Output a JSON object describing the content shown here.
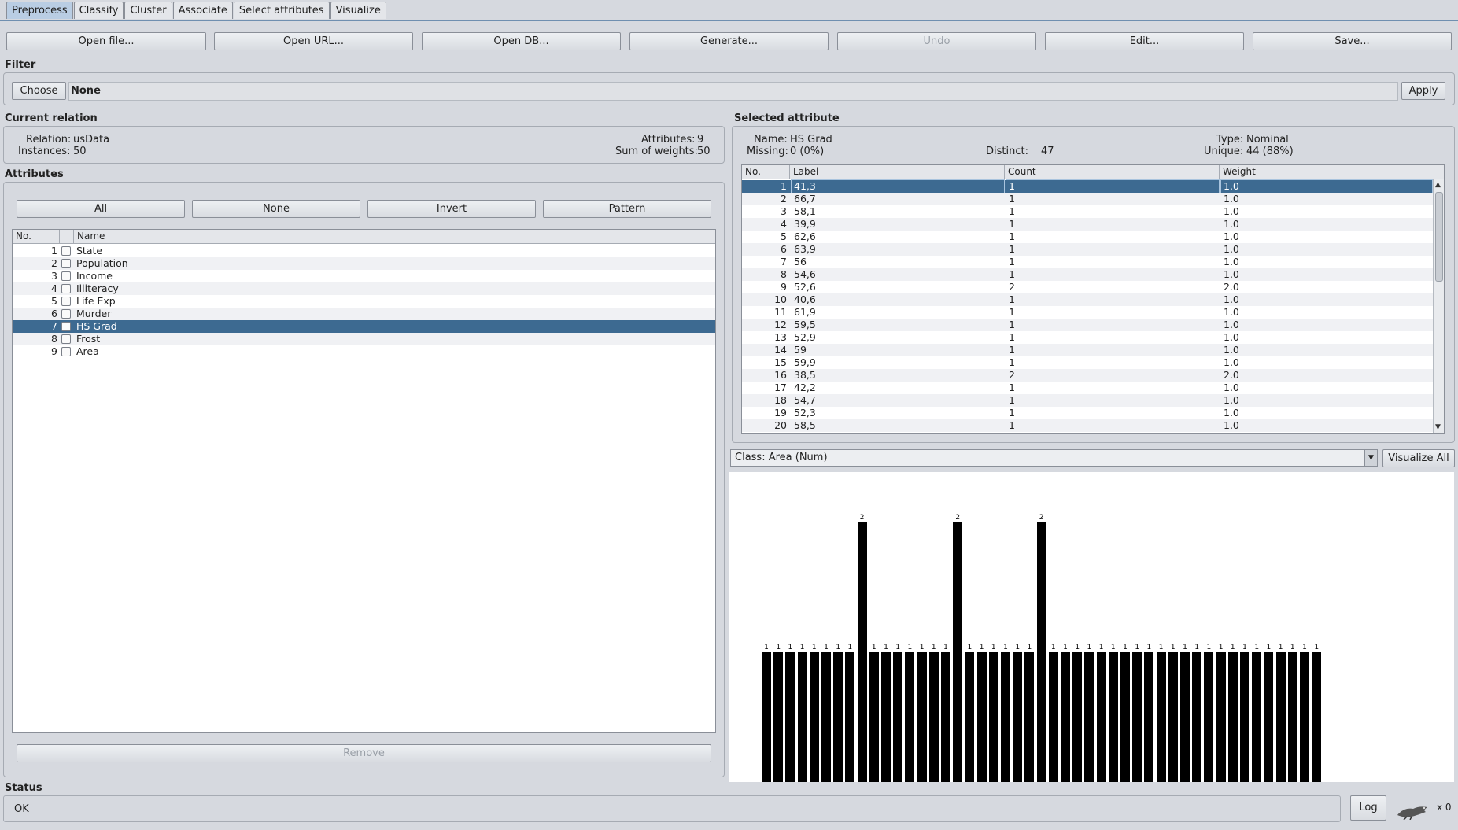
{
  "tabs": [
    "Preprocess",
    "Classify",
    "Cluster",
    "Associate",
    "Select attributes",
    "Visualize"
  ],
  "toolbar": {
    "open_file": "Open file...",
    "open_url": "Open URL...",
    "open_db": "Open DB...",
    "generate": "Generate...",
    "undo": "Undo",
    "edit": "Edit...",
    "save": "Save..."
  },
  "filter": {
    "title": "Filter",
    "choose": "Choose",
    "value": "None",
    "apply": "Apply"
  },
  "current_relation": {
    "title": "Current relation",
    "relation_label": "Relation:",
    "relation_value": "usData",
    "instances_label": "Instances:",
    "instances_value": "50",
    "attributes_label": "Attributes:",
    "attributes_value": "9",
    "sow_label": "Sum of weights:",
    "sow_value": "50"
  },
  "attributes": {
    "title": "Attributes",
    "buttons": {
      "all": "All",
      "none": "None",
      "invert": "Invert",
      "pattern": "Pattern"
    },
    "col_no": "No.",
    "col_name": "Name",
    "rows": [
      {
        "no": "1",
        "name": "State"
      },
      {
        "no": "2",
        "name": "Population"
      },
      {
        "no": "3",
        "name": "Income"
      },
      {
        "no": "4",
        "name": "Illiteracy"
      },
      {
        "no": "5",
        "name": "Life Exp"
      },
      {
        "no": "6",
        "name": "Murder"
      },
      {
        "no": "7",
        "name": "HS Grad"
      },
      {
        "no": "8",
        "name": "Frost"
      },
      {
        "no": "9",
        "name": "Area"
      }
    ],
    "selected_index": 6,
    "remove": "Remove"
  },
  "selected_attribute": {
    "title": "Selected attribute",
    "name_label": "Name:",
    "name_value": "HS Grad",
    "missing_label": "Missing:",
    "missing_value": "0 (0%)",
    "distinct_label": "Distinct:",
    "distinct_value": "47",
    "type_label": "Type:",
    "type_value": "Nominal",
    "unique_label": "Unique:",
    "unique_value": "44 (88%)",
    "col_no": "No.",
    "col_label": "Label",
    "col_count": "Count",
    "col_weight": "Weight",
    "rows": [
      {
        "no": "1",
        "label": "41,3",
        "count": "1",
        "weight": "1.0"
      },
      {
        "no": "2",
        "label": "66,7",
        "count": "1",
        "weight": "1.0"
      },
      {
        "no": "3",
        "label": "58,1",
        "count": "1",
        "weight": "1.0"
      },
      {
        "no": "4",
        "label": "39,9",
        "count": "1",
        "weight": "1.0"
      },
      {
        "no": "5",
        "label": "62,6",
        "count": "1",
        "weight": "1.0"
      },
      {
        "no": "6",
        "label": "63,9",
        "count": "1",
        "weight": "1.0"
      },
      {
        "no": "7",
        "label": "56",
        "count": "1",
        "weight": "1.0"
      },
      {
        "no": "8",
        "label": "54,6",
        "count": "1",
        "weight": "1.0"
      },
      {
        "no": "9",
        "label": "52,6",
        "count": "2",
        "weight": "2.0"
      },
      {
        "no": "10",
        "label": "40,6",
        "count": "1",
        "weight": "1.0"
      },
      {
        "no": "11",
        "label": "61,9",
        "count": "1",
        "weight": "1.0"
      },
      {
        "no": "12",
        "label": "59,5",
        "count": "1",
        "weight": "1.0"
      },
      {
        "no": "13",
        "label": "52,9",
        "count": "1",
        "weight": "1.0"
      },
      {
        "no": "14",
        "label": "59",
        "count": "1",
        "weight": "1.0"
      },
      {
        "no": "15",
        "label": "59,9",
        "count": "1",
        "weight": "1.0"
      },
      {
        "no": "16",
        "label": "38,5",
        "count": "2",
        "weight": "2.0"
      },
      {
        "no": "17",
        "label": "42,2",
        "count": "1",
        "weight": "1.0"
      },
      {
        "no": "18",
        "label": "54,7",
        "count": "1",
        "weight": "1.0"
      },
      {
        "no": "19",
        "label": "52,3",
        "count": "1",
        "weight": "1.0"
      },
      {
        "no": "20",
        "label": "58,5",
        "count": "1",
        "weight": "1.0"
      }
    ]
  },
  "class_select": {
    "value": "Class: Area (Num)",
    "visualize_all": "Visualize All"
  },
  "chart_data": {
    "type": "bar",
    "values": [
      1,
      1,
      1,
      1,
      1,
      1,
      1,
      1,
      2,
      1,
      1,
      1,
      1,
      1,
      1,
      1,
      2,
      1,
      1,
      1,
      1,
      1,
      1,
      2,
      1,
      1,
      1,
      1,
      1,
      1,
      1,
      1,
      1,
      1,
      1,
      1,
      1,
      1,
      1,
      1,
      1,
      1,
      1,
      1,
      1,
      1,
      1
    ],
    "ylim": [
      0,
      2
    ]
  },
  "status": {
    "title": "Status",
    "text": "OK",
    "log": "Log",
    "x_count": "x 0"
  }
}
